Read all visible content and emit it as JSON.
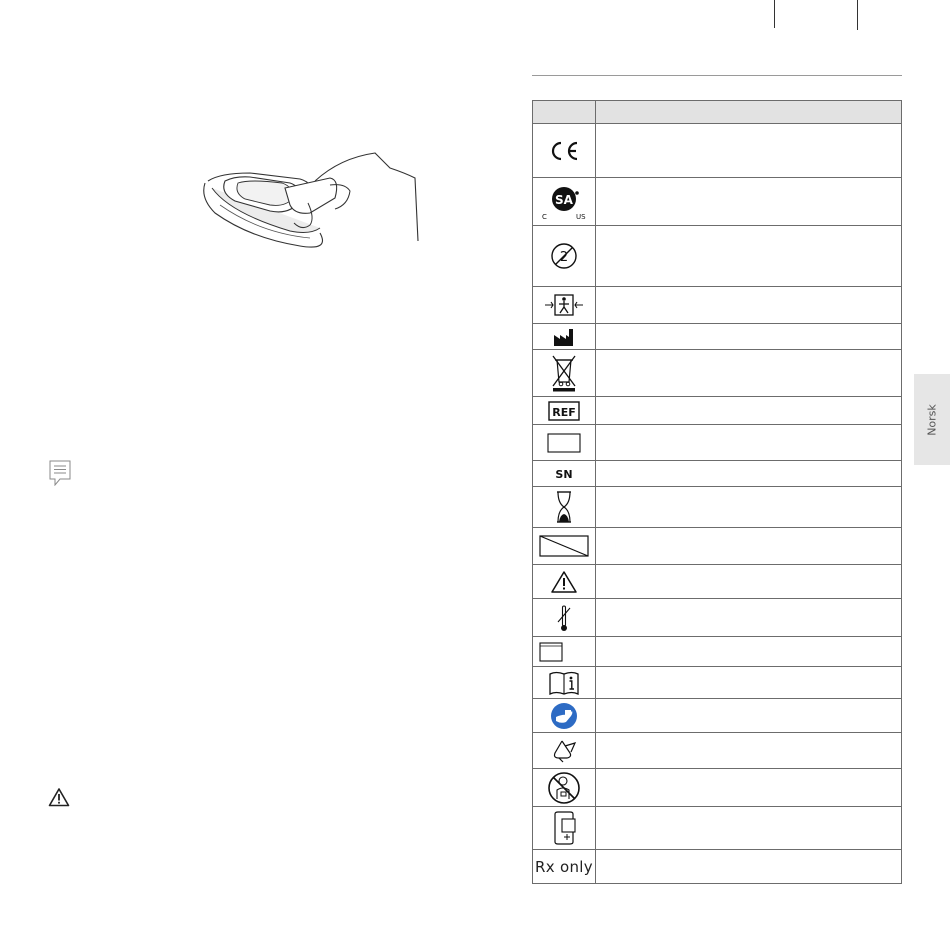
{
  "symbols_table": {
    "header": {
      "symbol": "",
      "description": ""
    },
    "rows": [
      {
        "icon": "ce-mark-icon",
        "description": ""
      },
      {
        "icon": "csa-us-mark-icon",
        "description": ""
      },
      {
        "icon": "do-not-reuse-icon",
        "description": ""
      },
      {
        "icon": "type-bf-applied-part-icon",
        "description": ""
      },
      {
        "icon": "manufacturer-icon",
        "description": ""
      },
      {
        "icon": "weee-disposal-icon",
        "description": ""
      },
      {
        "icon": "ref-catalog-number-icon",
        "description": ""
      },
      {
        "icon": "lot-box-icon",
        "description": ""
      },
      {
        "icon": "serial-number-icon",
        "description": ""
      },
      {
        "icon": "hourglass-expiry-icon",
        "description": ""
      },
      {
        "icon": "non-sterile-icon",
        "description": ""
      },
      {
        "icon": "warning-icon",
        "description": ""
      },
      {
        "icon": "temperature-limit-icon",
        "description": ""
      },
      {
        "icon": "empty-box-icon",
        "description": ""
      },
      {
        "icon": "consult-instructions-icon",
        "description": ""
      },
      {
        "icon": "follow-instructions-blue-icon",
        "description": ""
      },
      {
        "icon": "recyclable-icon",
        "description": ""
      },
      {
        "icon": "no-pacemaker-icon",
        "description": ""
      },
      {
        "icon": "storage-icon",
        "description": ""
      },
      {
        "icon": "rx-only-icon",
        "text": "Rx only",
        "description": ""
      }
    ]
  },
  "side_tab": {
    "label": "Norsk"
  }
}
